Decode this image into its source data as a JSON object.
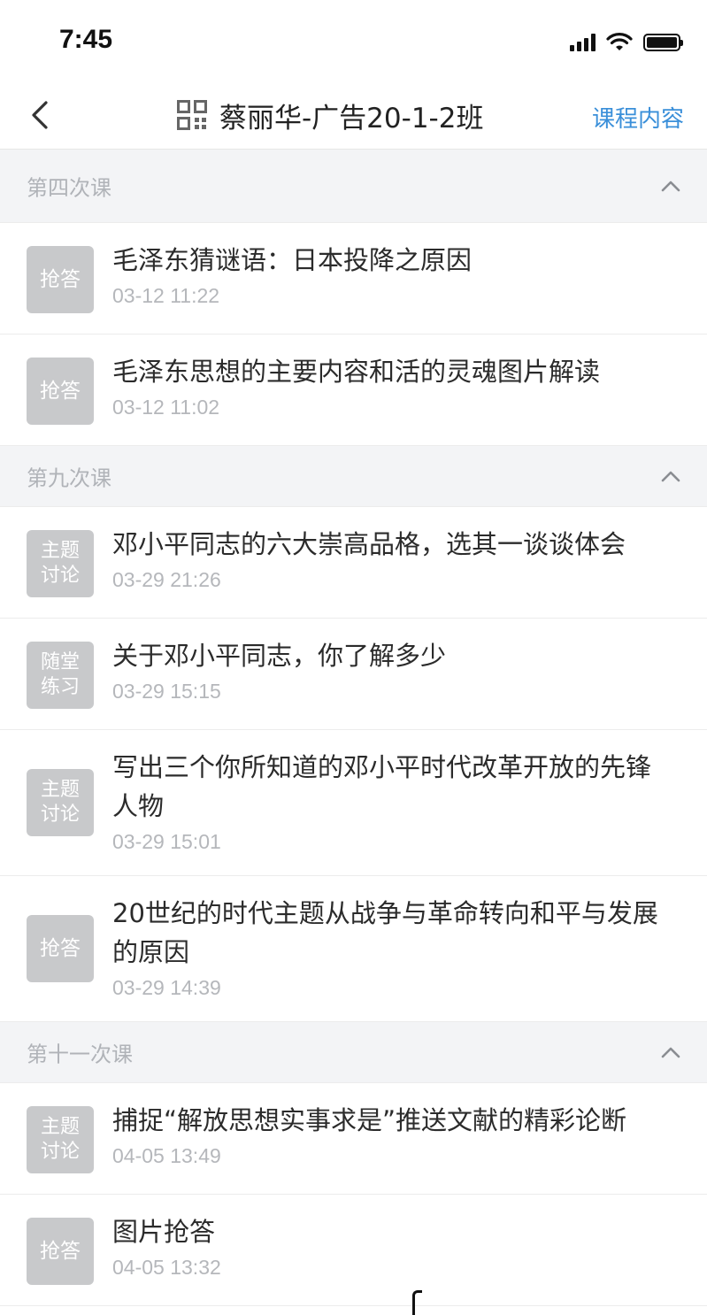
{
  "status_bar": {
    "time": "7:45"
  },
  "nav": {
    "title": "蔡丽华-广告20-1-2班",
    "right_action": "课程内容",
    "back_icon": "chevron-left-icon",
    "qr_icon": "qr-code-icon"
  },
  "colors": {
    "accent": "#3a8fd9",
    "badge_bg": "#c8c9cb",
    "section_bg": "#f3f4f6"
  },
  "sections": [
    {
      "label": "第四次课",
      "items": [
        {
          "badge": "抢答",
          "title": "毛泽东猜谜语：日本投降之原因",
          "time": "03-12 11:22"
        },
        {
          "badge": "抢答",
          "title": "毛泽东思想的主要内容和活的灵魂图片解读",
          "time": "03-12 11:02"
        }
      ]
    },
    {
      "label": "第九次课",
      "items": [
        {
          "badge": "主题\n讨论",
          "title": "邓小平同志的六大崇高品格，选其一谈谈体会",
          "time": "03-29 21:26"
        },
        {
          "badge": "随堂\n练习",
          "title": "关于邓小平同志，你了解多少",
          "time": "03-29 15:15"
        },
        {
          "badge": "主题\n讨论",
          "title": "写出三个你所知道的邓小平时代改革开放的先锋人物",
          "time": "03-29 15:01"
        },
        {
          "badge": "抢答",
          "title": "20世纪的时代主题从战争与革命转向和平与发展的原因",
          "time": "03-29 14:39"
        }
      ]
    },
    {
      "label": "第十一次课",
      "items": [
        {
          "badge": "主题\n讨论",
          "title": "捕捉“解放思想实事求是”推送文献的精彩论断",
          "time": "04-05 13:49"
        },
        {
          "badge": "抢答",
          "title": "图片抢答",
          "time": "04-05 13:32"
        }
      ]
    }
  ]
}
